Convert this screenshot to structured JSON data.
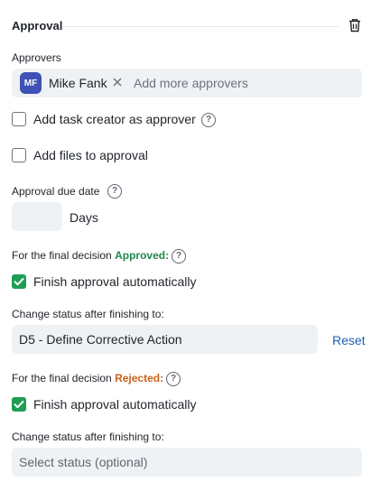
{
  "section": {
    "title": "Approval",
    "delete_icon": "trash-icon"
  },
  "approvers": {
    "label": "Approvers",
    "chip": {
      "initials": "MF",
      "name": "Mike Fank",
      "remove_icon": "close-icon",
      "avatar_color": "#3f51b5"
    },
    "placeholder": "Add more approvers"
  },
  "options": {
    "task_creator": {
      "label": "Add task creator as approver",
      "checked": false
    },
    "files": {
      "label": "Add files to approval",
      "checked": false
    }
  },
  "due_date": {
    "label": "Approval due date",
    "value": "",
    "unit": "Days"
  },
  "approved_block": {
    "prefix": "For the final decision",
    "decision": "Approved:",
    "decision_color": "#1f8a4c",
    "finish_label": "Finish approval automatically",
    "finish_checked": true,
    "status_label": "Change status after finishing to:",
    "status_value": "D5 - Define Corrective Action",
    "reset_label": "Reset"
  },
  "rejected_block": {
    "prefix": "For the final decision",
    "decision": "Rejected:",
    "decision_color": "#c7621b",
    "finish_label": "Finish approval automatically",
    "finish_checked": true,
    "status_label": "Change status after finishing to:",
    "status_placeholder": "Select status (optional)"
  },
  "colors": {
    "check_green": "#1f9d55",
    "field_bg": "#eff2f5",
    "link_blue": "#1f5fb3"
  }
}
